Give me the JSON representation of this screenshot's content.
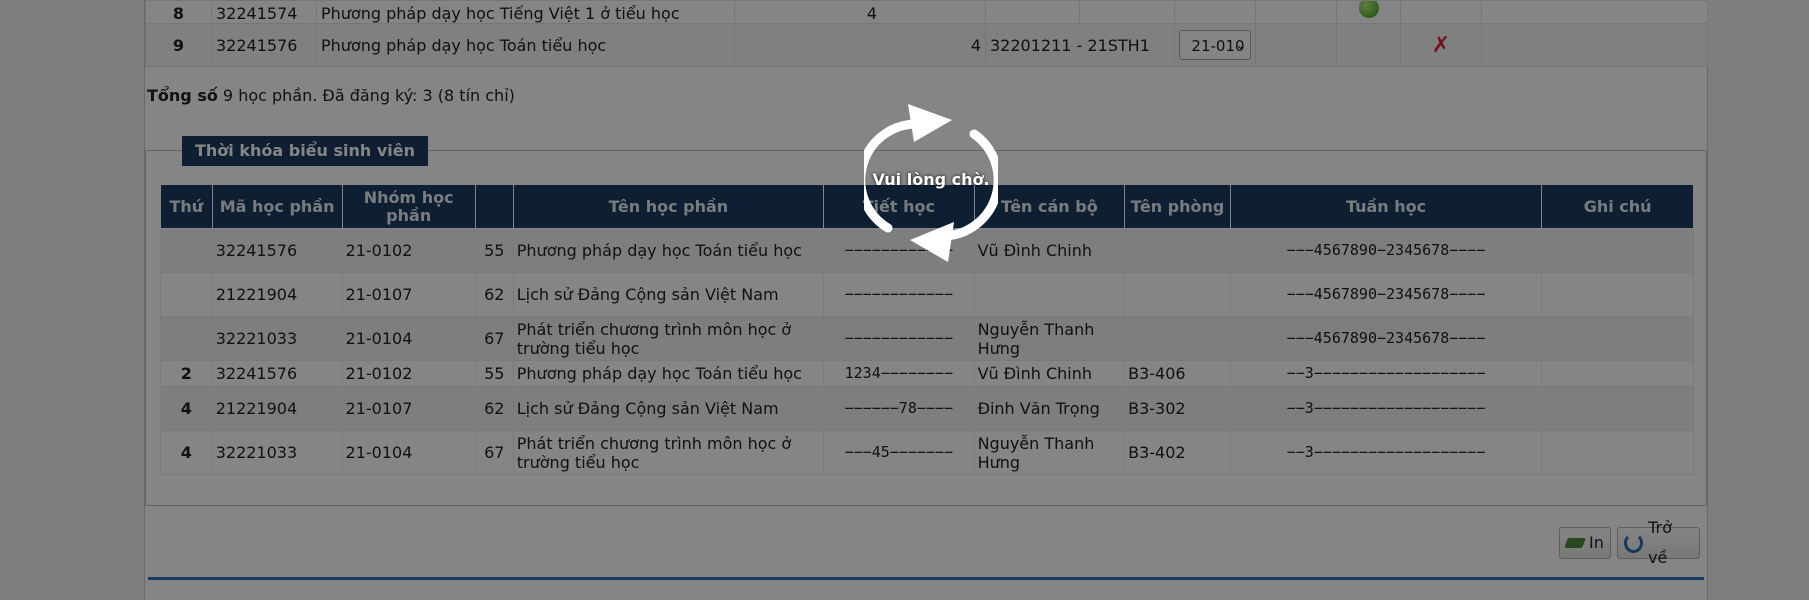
{
  "registration": {
    "rows": [
      {
        "stt": "8",
        "code": "32241574",
        "name": "Phương pháp dạy học Tiếng Việt 1 ở tiểu học",
        "credits": "4",
        "status": "ok"
      },
      {
        "stt": "9",
        "code": "32241576",
        "name": "Phương pháp dạy học Toán tiểu học",
        "credits": "4",
        "class": "32201211 - 21STH1",
        "group_selected": "21-010",
        "status": "remove"
      }
    ]
  },
  "summary": {
    "label": "Tổng số",
    "text": " 9 học phần. Đã đăng ký: 3 (8 tín chỉ)"
  },
  "timetable": {
    "legend": "Thời khóa biểu sinh viên",
    "headers": [
      "Thứ",
      "Mã học phần",
      "Nhóm học phần",
      "",
      "Tên học phần",
      "Tiết học",
      "Tên cán bộ",
      "Tên phòng",
      "Tuần học",
      "Ghi chú"
    ],
    "rows": [
      {
        "thu": "",
        "ma": "32241576",
        "nhom": "21-0102",
        "so": "55",
        "ten": "Phương pháp dạy học Toán tiểu học",
        "tiet": "−−−−−−−−−−−−",
        "canbo": "Vũ Đình Chinh",
        "phong": "",
        "tuan": "−−−4567890−2345678−−−−",
        "ghichu": ""
      },
      {
        "thu": "",
        "ma": "21221904",
        "nhom": "21-0107",
        "so": "62",
        "ten": "Lịch sử Đảng Cộng sản Việt Nam",
        "tiet": "−−−−−−−−−−−−",
        "canbo": "",
        "phong": "",
        "tuan": "−−−4567890−2345678−−−−",
        "ghichu": ""
      },
      {
        "thu": "",
        "ma": "32221033",
        "nhom": "21-0104",
        "so": "67",
        "ten": "Phát triển chương trình môn học ở trường tiểu học",
        "tiet": "−−−−−−−−−−−−",
        "canbo": "Nguyễn Thanh Hưng",
        "phong": "",
        "tuan": "−−−4567890−2345678−−−−",
        "ghichu": ""
      },
      {
        "thu": "2",
        "ma": "32241576",
        "nhom": "21-0102",
        "so": "55",
        "ten": "Phương pháp dạy học Toán tiểu học",
        "tiet": "1234−−−−−−−−",
        "canbo": "Vũ Đình Chinh",
        "phong": "B3-406",
        "tuan": "−−3−−−−−−−−−−−−−−−−−−−",
        "ghichu": ""
      },
      {
        "thu": "4",
        "ma": "21221904",
        "nhom": "21-0107",
        "so": "62",
        "ten": "Lịch sử Đảng Cộng sản Việt Nam",
        "tiet": "−−−−−−78−−−−",
        "canbo": "Đinh Văn Trọng",
        "phong": "B3-302",
        "tuan": "−−3−−−−−−−−−−−−−−−−−−−",
        "ghichu": ""
      },
      {
        "thu": "4",
        "ma": "32221033",
        "nhom": "21-0104",
        "so": "67",
        "ten": "Phát triển chương trình môn học ở trường tiểu học",
        "tiet": "−−−45−−−−−−−",
        "canbo": "Nguyễn Thanh Hưng",
        "phong": "B3-402",
        "tuan": "−−3−−−−−−−−−−−−−−−−−−−",
        "ghichu": ""
      }
    ]
  },
  "buttons": {
    "print": "In",
    "back": "Trở về"
  },
  "overlay": {
    "text": "Vui lòng chờ."
  },
  "colors": {
    "header_bg": "#1b3d63",
    "accent_line": "#2a6fb7",
    "remove": "#d9252f"
  }
}
